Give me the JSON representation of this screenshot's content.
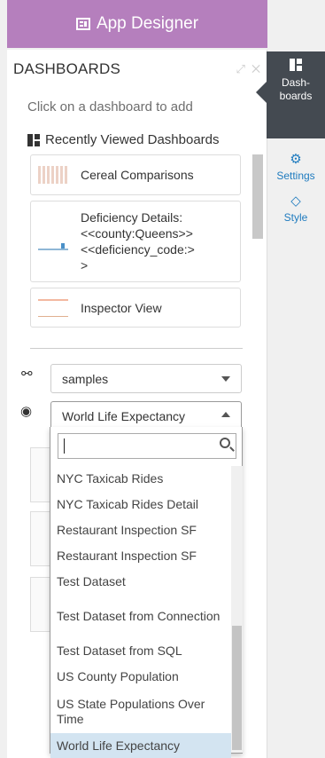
{
  "header": {
    "title": "App Designer"
  },
  "panel": {
    "title": "DASHBOARDS",
    "hint": "Click on a dashboard to add",
    "recent_title": "Recently Viewed Dashboards",
    "recent": [
      {
        "label": "Cereal Comparisons"
      },
      {
        "label_lines": [
          "Deficiency Details:",
          "<<county:Queens>>",
          "<<deficiency_code:>",
          ">"
        ]
      },
      {
        "label": "Inspector View"
      }
    ],
    "connection_select": {
      "value": "samples"
    },
    "dataset_select": {
      "value": "World Life Expectancy"
    },
    "dropdown": {
      "search_value": "",
      "options": [
        {
          "label": "NYC Taxicab Rides"
        },
        {
          "label": "NYC Taxicab Rides Detail"
        },
        {
          "label": "Restaurant Inspection SF"
        },
        {
          "label": "Restaurant Inspection SF"
        },
        {
          "label": "Test Dataset"
        },
        {
          "label": "Test Dataset from Connection"
        },
        {
          "label": "Test Dataset from SQL"
        },
        {
          "label": "US County Population"
        },
        {
          "label": "US State Populations Over Time"
        },
        {
          "label": "World Life Expectancy"
        }
      ],
      "selected": "World Life Expectancy"
    }
  },
  "rail": {
    "dashboards": "Dash-\nboards",
    "settings": "Settings",
    "style": "Style"
  },
  "colors": {
    "header": "#b57fbd",
    "rail_active": "#444a51",
    "link": "#1f7bbf",
    "selected_option": "#d3e4f1"
  },
  "icons": [
    "app-designer-icon",
    "expand-icon",
    "close-icon",
    "grid-icon",
    "link-icon",
    "datasets-icon",
    "search-icon",
    "dashboards-icon",
    "settings-icon",
    "style-icon"
  ]
}
